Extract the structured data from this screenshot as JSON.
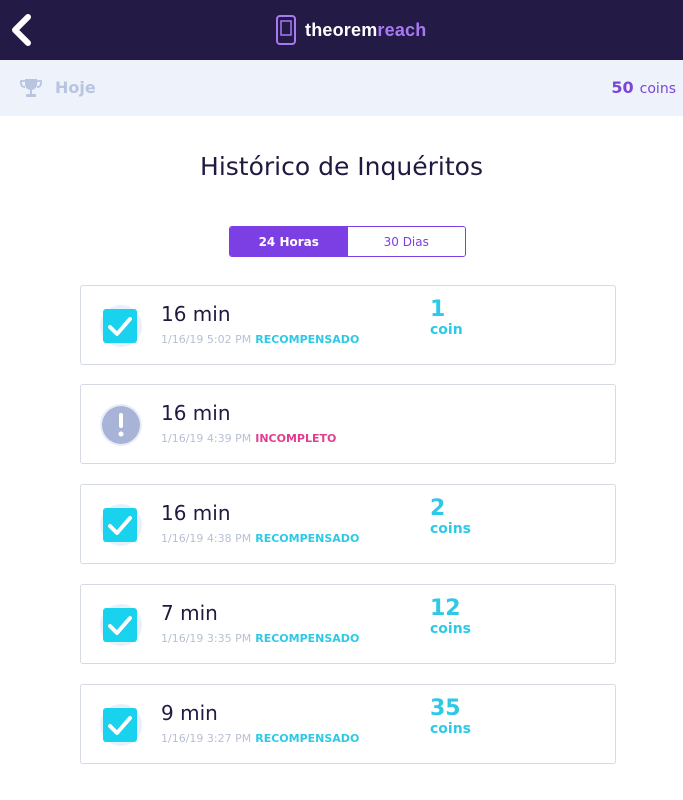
{
  "header": {
    "brand_a": "theorem",
    "brand_b": "reach",
    "back_icon": "chevron-left-icon"
  },
  "colors": {
    "header_bg": "#231a45",
    "accent_purple": "#7b3fe4",
    "reward_cyan": "#2ec9e6",
    "incomplete_pink": "#e23d8e",
    "subbar_bg": "#eef3fb"
  },
  "subbar": {
    "period": "Hoje",
    "balance": "50",
    "balance_unit": "coins"
  },
  "title": "Histórico de Inquéritos",
  "tabs": [
    {
      "label": "24 Horas",
      "selected": true
    },
    {
      "label": "30 Dias",
      "selected": false
    }
  ],
  "surveys": [
    {
      "icon": "checkbox-checked-icon",
      "duration": "16 min",
      "datetime": "1/16/19 5:02 PM",
      "status": "RECOMPENSADO",
      "reward": "1",
      "reward_unit": "coin"
    },
    {
      "icon": "alert-icon",
      "duration": "16 min",
      "datetime": "1/16/19 4:39 PM",
      "status": "INCOMPLETO",
      "reward": "",
      "reward_unit": ""
    },
    {
      "icon": "checkbox-checked-icon",
      "duration": "16 min",
      "datetime": "1/16/19 4:38 PM",
      "status": "RECOMPENSADO",
      "reward": "2",
      "reward_unit": "coins"
    },
    {
      "icon": "checkbox-checked-icon",
      "duration": "7 min",
      "datetime": "1/16/19 3:35 PM",
      "status": "RECOMPENSADO",
      "reward": "12",
      "reward_unit": "coins"
    },
    {
      "icon": "checkbox-checked-icon",
      "duration": "9 min",
      "datetime": "1/16/19 3:27 PM",
      "status": "RECOMPENSADO",
      "reward": "35",
      "reward_unit": "coins"
    }
  ]
}
